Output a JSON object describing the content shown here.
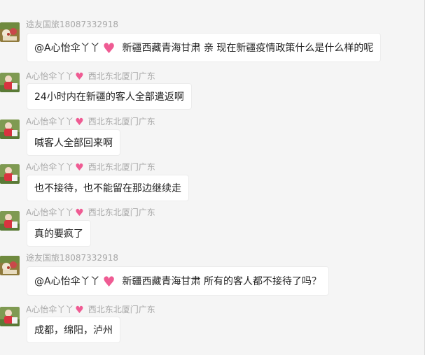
{
  "messages": [
    {
      "sender": "途友国旅18087332918",
      "mention": "@A心怡伞丫丫",
      "text": "新疆西藏青海甘肃  亲 现在新疆疫情政策什么是什么样的呢"
    },
    {
      "sender_name": "A心怡伞丫丫",
      "sender_region": "西北东北厦门广东",
      "text": "24小时内在新疆的客人全部遣返啊"
    },
    {
      "sender_name": "A心怡伞丫丫",
      "sender_region": "西北东北厦门广东",
      "text": "喊客人全部回来啊"
    },
    {
      "sender_name": "A心怡伞丫丫",
      "sender_region": "西北东北厦门广东",
      "text": "也不接待，也不能留在那边继续走"
    },
    {
      "sender_name": "A心怡伞丫丫",
      "sender_region": "西北东北厦门广东",
      "text": "真的要疯了"
    },
    {
      "sender": "途友国旅18087332918",
      "mention": "@A心怡伞丫丫",
      "text": "新疆西藏青海甘肃 所有的客人都不接待了吗？"
    },
    {
      "sender_name": "A心怡伞丫丫",
      "sender_region": "西北东北厦门广东",
      "text": "成都，绵阳，泸州"
    }
  ],
  "icons": {
    "heart": "♥"
  },
  "colors": {
    "background": "#f5f5f5",
    "bubble": "#ffffff",
    "sender_text": "#a8a8a8",
    "heart": "#ef5b93"
  }
}
